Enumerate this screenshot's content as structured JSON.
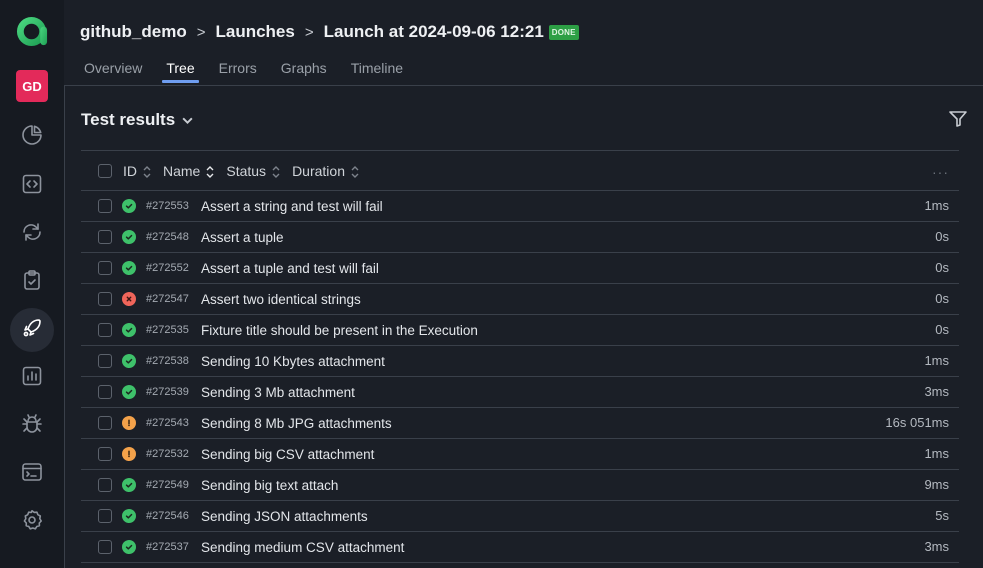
{
  "sidebar": {
    "avatar_initials": "GD",
    "items": [
      {
        "name": "dashboard",
        "icon": "pie-chart-icon",
        "active": false
      },
      {
        "name": "code",
        "icon": "code-icon",
        "active": false
      },
      {
        "name": "sync",
        "icon": "refresh-icon",
        "active": false
      },
      {
        "name": "test-cases",
        "icon": "clipboard-check-icon",
        "active": false
      },
      {
        "name": "launches",
        "icon": "rocket-icon",
        "active": true
      },
      {
        "name": "analytics",
        "icon": "bar-chart-icon",
        "active": false
      },
      {
        "name": "defects",
        "icon": "bug-icon",
        "active": false
      },
      {
        "name": "jobs",
        "icon": "terminal-icon",
        "active": false
      },
      {
        "name": "settings",
        "icon": "gear-icon",
        "active": false
      }
    ]
  },
  "header": {
    "breadcrumb": [
      "github_demo",
      "Launches",
      "Launch at 2024-09-06 12:21"
    ],
    "separator": ">",
    "badge": "DONE",
    "tabs": [
      {
        "label": "Overview",
        "active": false
      },
      {
        "label": "Tree",
        "active": true
      },
      {
        "label": "Errors",
        "active": false
      },
      {
        "label": "Graphs",
        "active": false
      },
      {
        "label": "Timeline",
        "active": false
      }
    ]
  },
  "section": {
    "title": "Test results"
  },
  "table": {
    "columns": [
      "ID",
      "Name",
      "Status",
      "Duration"
    ],
    "more": "···",
    "rows": [
      {
        "id": "#272553",
        "name": "Assert a string and test will fail",
        "status": "passed",
        "duration": "1ms"
      },
      {
        "id": "#272548",
        "name": "Assert a tuple",
        "status": "passed",
        "duration": "0s"
      },
      {
        "id": "#272552",
        "name": "Assert a tuple and test will fail",
        "status": "passed",
        "duration": "0s"
      },
      {
        "id": "#272547",
        "name": "Assert two identical strings",
        "status": "failed",
        "duration": "0s"
      },
      {
        "id": "#272535",
        "name": "Fixture title should be present in the Execution",
        "status": "passed",
        "duration": "0s"
      },
      {
        "id": "#272538",
        "name": "Sending 10 Kbytes attachment",
        "status": "passed",
        "duration": "1ms"
      },
      {
        "id": "#272539",
        "name": "Sending 3 Mb attachment",
        "status": "passed",
        "duration": "3ms"
      },
      {
        "id": "#272543",
        "name": "Sending 8 Mb JPG attachments",
        "status": "broken",
        "duration": "16s 051ms"
      },
      {
        "id": "#272532",
        "name": "Sending big CSV attachment",
        "status": "broken",
        "duration": "1ms"
      },
      {
        "id": "#272549",
        "name": "Sending big text attach",
        "status": "passed",
        "duration": "9ms"
      },
      {
        "id": "#272546",
        "name": "Sending JSON attachments",
        "status": "passed",
        "duration": "5s"
      },
      {
        "id": "#272537",
        "name": "Sending medium CSV attachment",
        "status": "passed",
        "duration": "3ms"
      }
    ]
  },
  "colors": {
    "passed": "#3ec16a",
    "failed": "#f0655a",
    "broken": "#f4a24a",
    "accent": "#6f9df0",
    "badge": "#2d9f45",
    "avatar": "#e32a5a",
    "logo": "#2fc06a"
  }
}
